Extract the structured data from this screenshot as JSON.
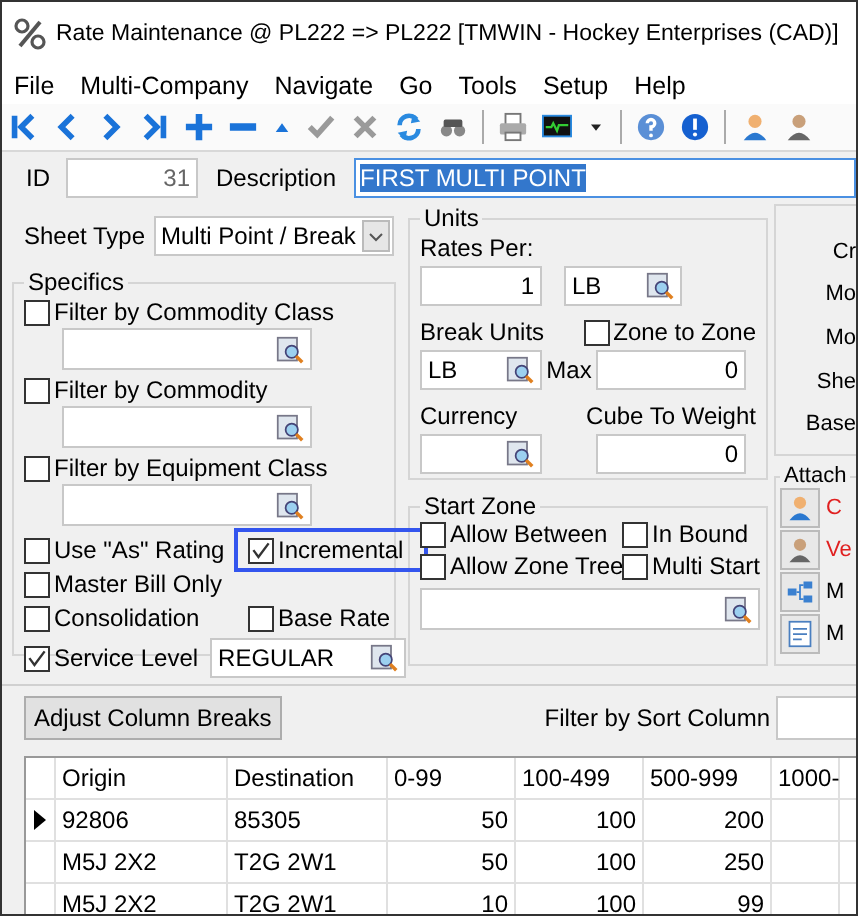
{
  "window": {
    "title": "Rate Maintenance @ PL222 => PL222 [TMWIN - Hockey Enterprises (CAD)]"
  },
  "menu": [
    "File",
    "Multi-Company",
    "Navigate",
    "Go",
    "Tools",
    "Setup",
    "Help"
  ],
  "id": {
    "label": "ID",
    "value": "31"
  },
  "description": {
    "label": "Description",
    "value": "FIRST MULTI POINT",
    "selected": true
  },
  "sheet_type": {
    "label": "Sheet Type",
    "value": "Multi Point / Break"
  },
  "specifics": {
    "title": "Specifics",
    "filters": [
      {
        "label": "Filter by Commodity Class",
        "checked": false
      },
      {
        "label": "Filter by Commodity",
        "checked": false
      },
      {
        "label": "Filter by Equipment Class",
        "checked": false
      }
    ],
    "options": [
      [
        {
          "kind": "checkbox",
          "label": "Use \"As\" Rating",
          "checked": false,
          "highlighted": false
        },
        {
          "kind": "checkbox",
          "label": "Incremental",
          "checked": true,
          "highlighted": true
        }
      ],
      [
        {
          "kind": "checkbox",
          "label": "Master Bill Only",
          "checked": false,
          "highlighted": false
        }
      ],
      [
        {
          "kind": "checkbox",
          "label": "Consolidation",
          "checked": false,
          "highlighted": false
        },
        {
          "kind": "checkbox",
          "label": "Base Rate",
          "checked": false,
          "highlighted": false
        }
      ],
      [
        {
          "kind": "lookup",
          "label": "Service Level",
          "checked": true,
          "highlighted": false,
          "value": "REGULAR"
        }
      ]
    ]
  },
  "units": {
    "title": "Units",
    "rates_per": {
      "label": "Rates Per:",
      "value": "1",
      "unit": "LB"
    },
    "break_units": {
      "label": "Break Units",
      "value": "LB"
    },
    "zone_to_zone": {
      "label": "Zone to Zone",
      "checked": false
    },
    "max": {
      "label": "Max",
      "value": "0"
    },
    "currency": {
      "label": "Currency"
    },
    "cube_to_weight": {
      "label": "Cube To Weight",
      "value": "0"
    }
  },
  "side_labels": [
    "Cr",
    "Mo",
    "Mo",
    "She",
    "Base"
  ],
  "start_zone": {
    "title": "Start Zone",
    "options": [
      {
        "label": "Allow Between",
        "checked": false
      },
      {
        "label": "In Bound",
        "checked": false
      },
      {
        "label": "Allow Zone Tree",
        "checked": false
      },
      {
        "label": "Multi Start",
        "checked": false
      }
    ]
  },
  "attach": {
    "title": "Attach",
    "items": [
      {
        "kind": "person-blue",
        "text": "C",
        "color": "#e02020"
      },
      {
        "kind": "person-grey",
        "text": "Ve",
        "color": "#e02020"
      },
      {
        "kind": "tree",
        "text": "M",
        "color": "#000000"
      },
      {
        "kind": "note",
        "text": "M",
        "color": "#000000"
      }
    ]
  },
  "adjust_button": "Adjust Column Breaks",
  "filter": {
    "label": "Filter by Sort Column"
  },
  "grid": {
    "columns": [
      "Origin",
      "Destination",
      "0-99",
      "100-499",
      "500-999",
      "1000-"
    ],
    "rows": [
      {
        "selected": true,
        "cells": [
          "92806",
          "85305",
          "50",
          "100",
          "200"
        ]
      },
      {
        "selected": false,
        "cells": [
          "M5J 2X2",
          "T2G 2W1",
          "50",
          "100",
          "250"
        ]
      },
      {
        "selected": false,
        "cells": [
          "M5J 2X2",
          "T2G 2W1",
          "10",
          "100",
          "99"
        ]
      }
    ]
  }
}
